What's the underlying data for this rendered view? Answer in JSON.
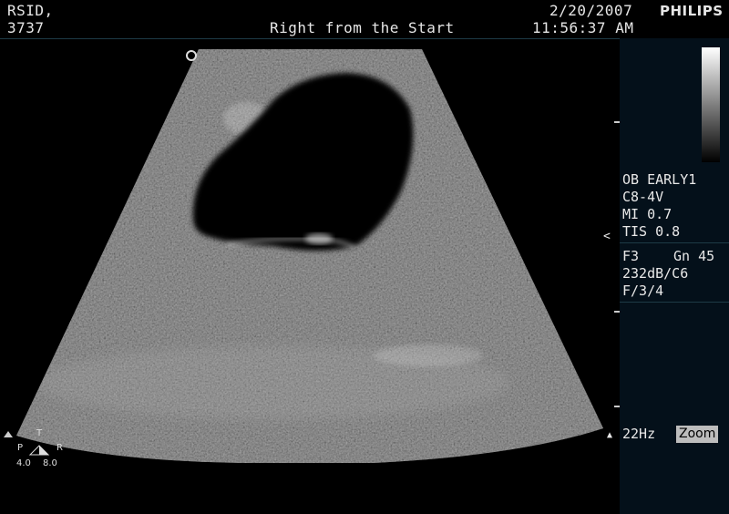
{
  "header": {
    "patient_line1": "RSID,",
    "patient_line2": "3737",
    "title": "Right from the Start",
    "date": "2/20/2007",
    "time": "11:56:37 AM",
    "brand": "PHILIPS"
  },
  "panel": {
    "exam": "OB EARLY1",
    "probe": "C8-4V",
    "mi": "MI 0.7",
    "tis": "TIS 0.8",
    "freq": "F3",
    "gain": "Gn 45",
    "dynamic": "232dB/C6",
    "frame": "F/3/4",
    "rate": "22Hz",
    "zoom_label": "Zoom",
    "focus_marker": "<"
  },
  "orientation": {
    "t_label": "T",
    "p_label": "P",
    "r_label": "R",
    "scale_left": "4.0",
    "scale_right": "8.0"
  },
  "colors": {
    "background": "#000000",
    "panel": "#04101a",
    "accent_line": "#1d3a46"
  }
}
